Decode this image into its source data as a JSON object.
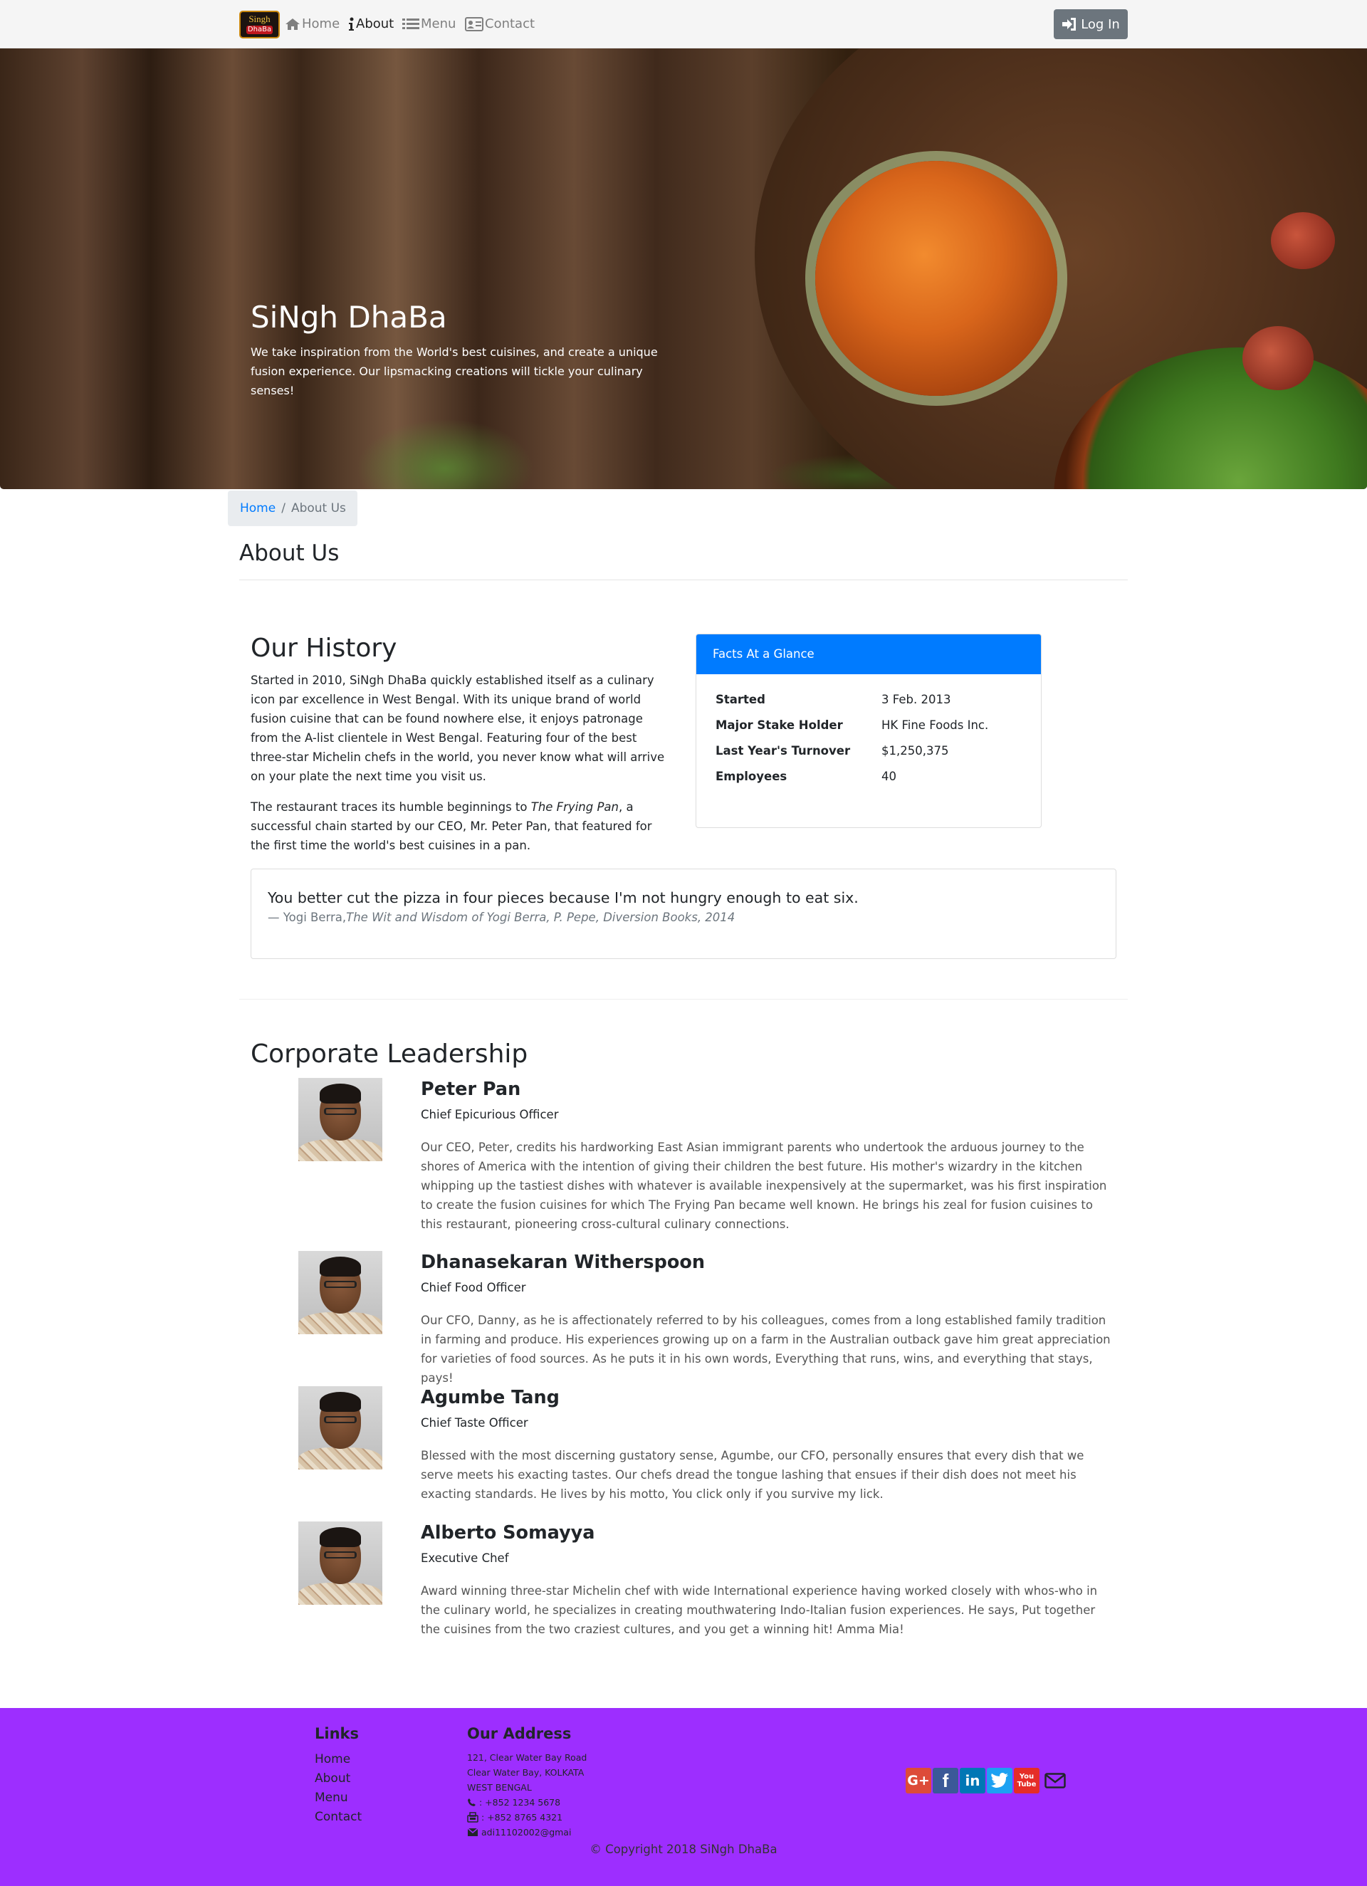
{
  "nav": {
    "logo_line1": "Singh",
    "logo_line2": "DhaBa",
    "home": "Home",
    "about": "About",
    "menu": "Menu",
    "contact": "Contact",
    "login": "Log In"
  },
  "hero": {
    "title": "SiNgh DhaBa",
    "text": "We take inspiration from the World's best cuisines, and create a unique fusion experience. Our lipsmacking creations will tickle your culinary senses!"
  },
  "breadcrumb": {
    "home": "Home",
    "separator": "/",
    "current": "About Us"
  },
  "page_title": "About Us",
  "history": {
    "heading": "Our History",
    "p1": "Started in 2010, SiNgh DhaBa quickly established itself as a culinary icon par excellence in West Bengal. With its unique brand of world fusion cuisine that can be found nowhere else, it enjoys patronage from the A-list clientele in West Bengal. Featuring four of the best three-star Michelin chefs in the world, you never know what will arrive on your plate the next time you visit us.",
    "p2_before": "The restaurant traces its humble beginnings to ",
    "p2_em": "The Frying Pan",
    "p2_after": ", a successful chain started by our CEO, Mr. Peter Pan, that featured for the first time the world's best cuisines in a pan."
  },
  "facts": {
    "header": "Facts At a Glance",
    "rows": [
      {
        "label": "Started",
        "value": "3 Feb. 2013"
      },
      {
        "label": "Major Stake Holder",
        "value": "HK Fine Foods Inc."
      },
      {
        "label": "Last Year's Turnover",
        "value": "$1,250,375"
      },
      {
        "label": "Employees",
        "value": "40"
      }
    ]
  },
  "quote": {
    "text": "You better cut the pizza in four pieces because I'm not hungry enough to eat six.",
    "author": "— Yogi Berra,",
    "source": "The Wit and Wisdom of Yogi Berra, P. Pepe, Diversion Books, 2014"
  },
  "leadership": {
    "heading": "Corporate Leadership",
    "leaders": [
      {
        "name": "Peter Pan",
        "role": "Chief Epicurious Officer",
        "bio": "Our CEO, Peter, credits his hardworking East Asian immigrant parents who undertook the arduous journey to the shores of America with the intention of giving their children the best future. His mother's wizardry in the kitchen whipping up the tastiest dishes with whatever is available inexpensively at the supermarket, was his first inspiration to create the fusion cuisines for which The Frying Pan became well known. He brings his zeal for fusion cuisines to this restaurant, pioneering cross-cultural culinary connections."
      },
      {
        "name": "Dhanasekaran Witherspoon",
        "role": "Chief Food Officer",
        "bio": "Our CFO, Danny, as he is affectionately referred to by his colleagues, comes from a long established family tradition in farming and produce. His experiences growing up on a farm in the Australian outback gave him great appreciation for varieties of food sources. As he puts it in his own words, Everything that runs, wins, and everything that stays, pays!"
      },
      {
        "name": "Agumbe Tang",
        "role": "Chief Taste Officer",
        "bio": "Blessed with the most discerning gustatory sense, Agumbe, our CFO, personally ensures that every dish that we serve meets his exacting tastes. Our chefs dread the tongue lashing that ensues if their dish does not meet his exacting standards. He lives by his motto, You click only if you survive my lick."
      },
      {
        "name": "Alberto Somayya",
        "role": "Executive Chef",
        "bio": "Award winning three-star Michelin chef with wide International experience having worked closely with whos-who in the culinary world, he specializes in creating mouthwatering Indo-Italian fusion experiences. He says, Put together the cuisines from the two craziest cultures, and you get a winning hit! Amma Mia!"
      }
    ]
  },
  "footer": {
    "links_heading": "Links",
    "links": [
      "Home",
      "About",
      "Menu",
      "Contact"
    ],
    "address_heading": "Our Address",
    "address": [
      "121, Clear Water Bay Road",
      "Clear Water Bay, KOLKATA",
      "WEST BENGAL"
    ],
    "phone": ": +852 1234 5678",
    "fax": ": +852 8765 4321",
    "email": "adi11102002@gmai",
    "copyright": "© Copyright 2018 SiNgh DhaBa",
    "social": [
      {
        "icon": "google-plus-icon",
        "label": "G+",
        "color": "#dd4b39"
      },
      {
        "icon": "facebook-icon",
        "label": "f",
        "color": "#3b5998"
      },
      {
        "icon": "linkedin-icon",
        "label": "in",
        "color": "#0077b5"
      },
      {
        "icon": "twitter-icon",
        "label": "t",
        "color": "#1da1f2"
      },
      {
        "icon": "youtube-icon",
        "label": "You Tube",
        "color": "#e52d27"
      },
      {
        "icon": "mail-icon",
        "label": "",
        "color": "#212529"
      }
    ]
  },
  "colors": {
    "primary": "#007bff",
    "footer_bg": "#9d2eff",
    "login_bg": "#6c757d"
  }
}
